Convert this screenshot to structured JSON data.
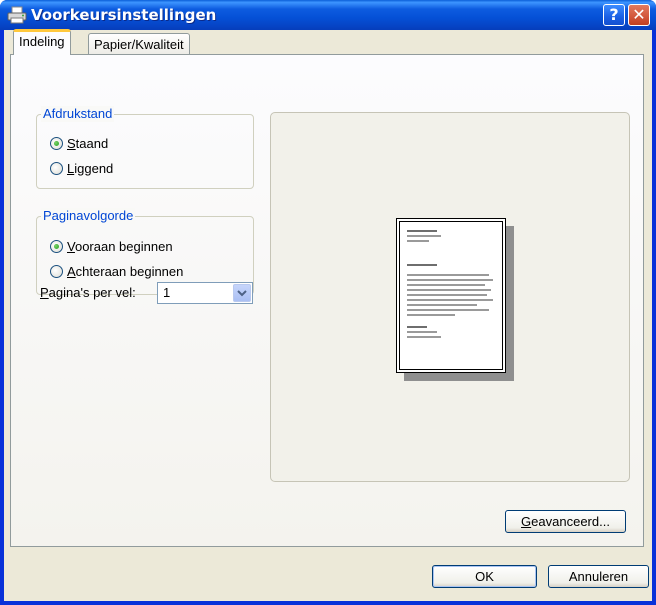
{
  "window": {
    "title": "Voorkeursinstellingen",
    "help_button": "?",
    "close_button": "✕"
  },
  "tabs": [
    {
      "label": "Indeling",
      "active": true
    },
    {
      "label": "Papier/Kwaliteit",
      "active": false
    }
  ],
  "orientation": {
    "legend": "Afdrukstand",
    "options": [
      {
        "access_key": "S",
        "rest": "taand",
        "label": "Staand",
        "selected": true
      },
      {
        "access_key": "L",
        "rest": "iggend",
        "label": "Liggend",
        "selected": false
      }
    ]
  },
  "page_order": {
    "legend": "Paginavolgorde",
    "options": [
      {
        "access_key": "V",
        "rest": "ooraan beginnen",
        "label": "Vooraan beginnen",
        "selected": true
      },
      {
        "access_key": "A",
        "rest": "chteraan beginnen",
        "label": "Achteraan beginnen",
        "selected": false
      }
    ]
  },
  "pages_per_sheet": {
    "access_key": "P",
    "rest": "agina's per vel:",
    "label": "Pagina's per vel:",
    "value": "1"
  },
  "buttons": {
    "advanced_key": "G",
    "advanced_rest": "eavanceerd...",
    "advanced": "Geavanceerd...",
    "ok": "OK",
    "cancel": "Annuleren"
  },
  "colors": {
    "titlebar": "#0550d6",
    "dialog_bg": "#ece9d8",
    "group_label": "#0046d5",
    "active_tab_accent": "#ffc83c"
  }
}
